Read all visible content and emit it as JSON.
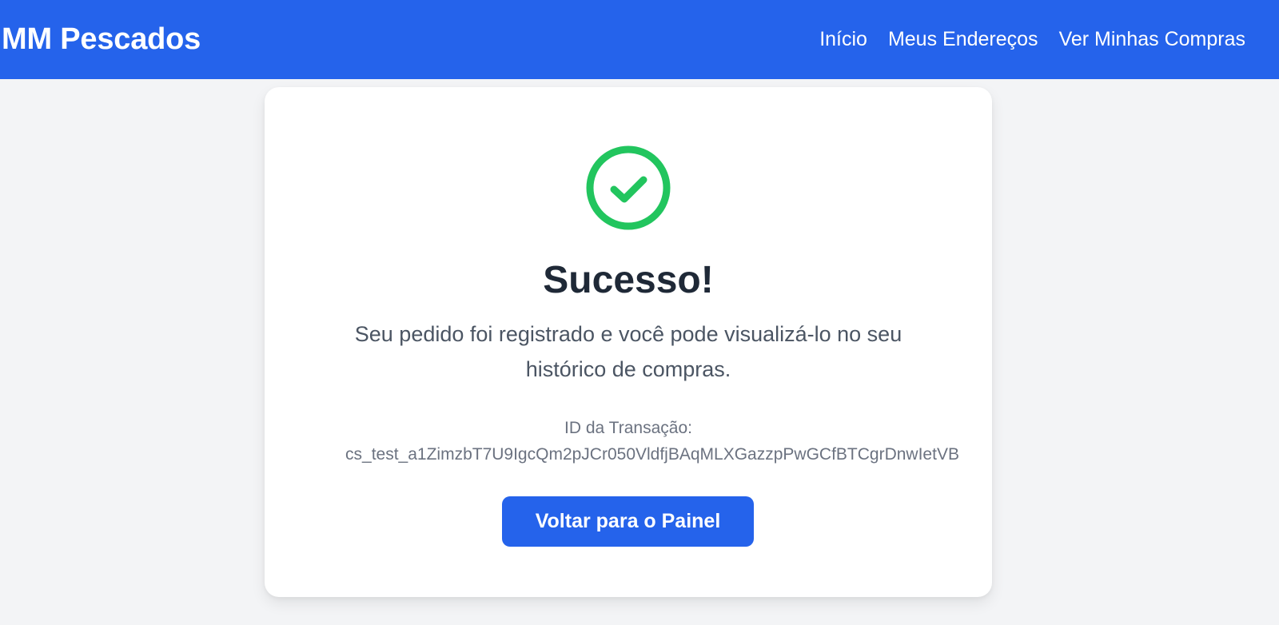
{
  "navbar": {
    "brand": "MM Pescados",
    "links": [
      {
        "label": "Início"
      },
      {
        "label": "Meus Endereços"
      },
      {
        "label": "Ver Minhas Compras"
      }
    ]
  },
  "card": {
    "icon": "check-circle-icon",
    "title": "Sucesso!",
    "message": "Seu pedido foi registrado e você pode visualizá-lo no seu histórico de compras.",
    "transaction_label": "ID da Transação:",
    "transaction_id": "cs_test_a1ZimzbT7U9IgcQm2pJCr050VldfjBAqMLXGazzpPwGCfBTCgrDnwIetVB",
    "button_label": "Voltar para o Painel"
  },
  "colors": {
    "primary": "#2563eb",
    "success": "#22c55e",
    "background": "#f3f4f6"
  }
}
